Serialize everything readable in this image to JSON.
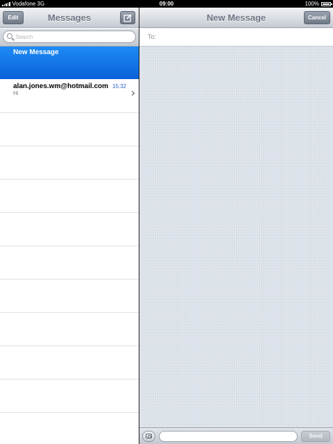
{
  "status_bar": {
    "carrier": "Vodafone 3G",
    "time": "09:00",
    "battery": "100%"
  },
  "left": {
    "nav": {
      "edit_label": "Edit",
      "title": "Messages"
    },
    "search": {
      "placeholder": "Search"
    },
    "new_message_label": "New Message",
    "conversations": [
      {
        "sender": "alan.jones.wm@hotmail.com",
        "time": "15:32",
        "preview": "Hi"
      }
    ]
  },
  "right": {
    "nav": {
      "title": "New Message",
      "cancel_label": "Cancel"
    },
    "to_label": "To:",
    "send_label": "Send"
  },
  "colors": {
    "selected_row": "#0a61d9",
    "timestamp": "#2a64c8"
  }
}
